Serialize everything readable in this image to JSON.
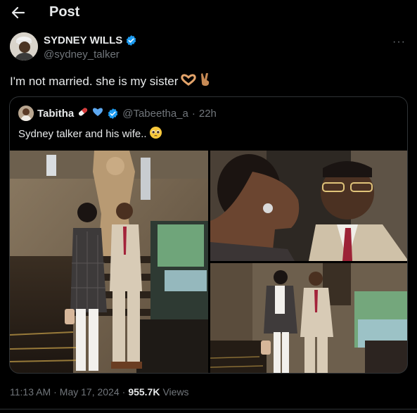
{
  "header": {
    "title": "Post",
    "back_icon": "arrow-left-icon"
  },
  "author": {
    "name": "SYDNEY WILLS",
    "handle": "@sydney_talker",
    "verified": true,
    "more_label": "···"
  },
  "post": {
    "text": "I'm not married. she is my sister",
    "emojis": [
      "heart-hands-emoji",
      "victory-hand-emoji"
    ]
  },
  "quote": {
    "name": "Tabitha",
    "name_emojis": [
      "pill-emoji",
      "blue-heart-emoji"
    ],
    "verified": true,
    "handle": "@Tabeetha_a",
    "separator": "·",
    "time": "22h",
    "text": "Sydney talker and his wife..",
    "text_emoji": "pleading-face-emoji",
    "photos": [
      "couple-full-length-staircase-photo",
      "couple-closeup-selfie-photo",
      "couple-full-length-window-photo"
    ]
  },
  "meta": {
    "time": "11:13 AM",
    "separator": "·",
    "date": "May 17, 2024",
    "views_count": "955.7K",
    "views_label": "Views"
  },
  "colors": {
    "background": "#000000",
    "text": "#e7e9ea",
    "muted": "#71767b",
    "verified": "#1d9bf0",
    "border": "#2f3336"
  }
}
